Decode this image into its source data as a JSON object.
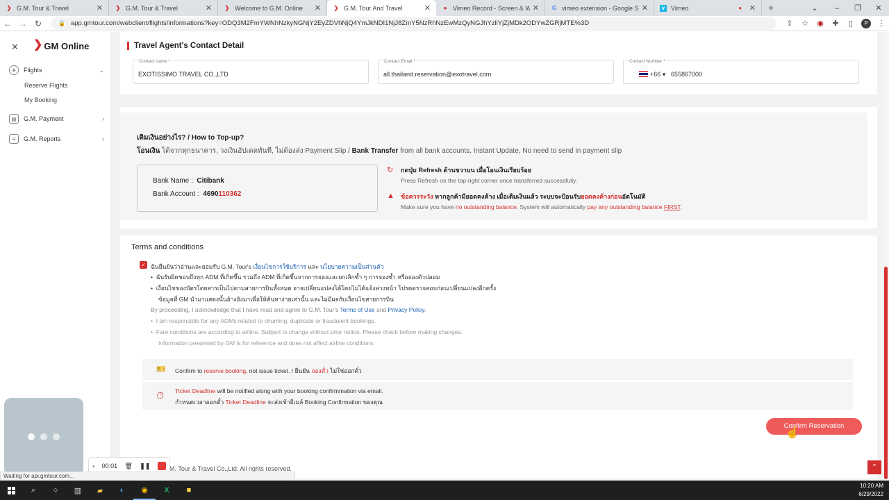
{
  "browser": {
    "tabs": [
      {
        "title": "G.M. Tour & Travel",
        "active": false
      },
      {
        "title": "G.M. Tour & Travel",
        "active": false
      },
      {
        "title": "Welcome to G.M. Online",
        "active": false
      },
      {
        "title": "G.M. Tour And Travel",
        "active": true
      },
      {
        "title": "Vimeo Record - Screen & Webc",
        "active": false
      },
      {
        "title": "vimeo extension - Google Searc",
        "active": false
      },
      {
        "title": "Vimeo",
        "active": false
      }
    ],
    "new_tab": "+",
    "url": "app.gmtour.com/webclient/flights/informations?key=ODQ3M2FmYWNhNzkyNGNjY2EyZDVhNjQ4YmJkNDI1NjJ8ZmY5NzRhNzEwMzQyNGJhYzllYjZjMDk2ODYwZGRjMTE%3D",
    "status": "Waiting for api.gmtour.com..."
  },
  "sidebar": {
    "logo": "GM Online",
    "items": [
      {
        "label": "Flights"
      },
      {
        "label": "G.M. Payment"
      },
      {
        "label": "G.M. Reports"
      }
    ],
    "sub_items": [
      "Reserve Flights",
      "My Booking"
    ]
  },
  "contact": {
    "title": "Travel Agent's Contact Detail",
    "name_label": "Contact name *",
    "name_value": "EXOTISSIMO TRAVEL CO.,LTD",
    "email_label": "Contact Email *",
    "email_value": "all.thailand.reservation@exotravel.com",
    "number_label": "Contact Number *",
    "country_code": "+66",
    "number_value": "655867000"
  },
  "topup": {
    "title": "เติมเงินอย่างไร? / How to Top-up?",
    "line_bold1": "โอนเงิน",
    "line_text1": " ได้จากทุกธนาคาร, วงเงินอัปเดตทันที, ไม่ต้องส่ง Payment Slip / ",
    "line_bold2": "Bank Transfer",
    "line_text2": " from all bank accounts, Instant Update, No need to send in payment slip",
    "bank_name_label": "Bank Name :",
    "bank_name": "Citibank",
    "bank_account_label": "Bank Account :",
    "bank_account_prefix": "4690",
    "bank_account_suffix": "110362",
    "refresh_title": "กดปุ่ม Refresh ด้านขวาบน เมื่อโอนเงินเรียบร้อย",
    "refresh_sub": "Press Refresh on the top-right corner once transferred successfully.",
    "warn_red": "ข้อควรระวัง",
    "warn_title1": " หากลูกค้ามียอดคงค้าง เมื่อเติมเงินแล้ว ระบบจะป้อนรับ",
    "warn_red2": "ยอดคงค้างก่อน",
    "warn_title2": "อัตโนมัติ",
    "warn_sub1": "Make sure you have ",
    "warn_sub_red1": "no outstanding balance",
    "warn_sub2": ". System will automatically ",
    "warn_sub_red2": "pay any outstanding balance",
    "warn_sub_red3": "FIRST",
    "warn_sub3": "."
  },
  "terms": {
    "title": "Terms and conditions",
    "agree_th": "ฉันยืนยันว่าอ่านและยอมรับ G.M. Tour's ",
    "agree_th_link1": "เงื่อนไขการใช้บริการ",
    "agree_th_and": " และ ",
    "agree_th_link2": "นโยบายความเป็นส่วนตัว",
    "th_bullets": [
      "ฉันรับผิดชอบถึงทุก ADM ที่เกิดขึ้น รวมถึง ADM ที่เกิดขึ้นจากการจองและยกเลิกซ้ำ ๆ การจองซ้ำ หรือจองตัวปลอม",
      "เงื่อนไขของบัตรโดยสารเป็นไปตามสายการบินทั้งหมด อาจเปลี่ยนแปลงได้โดยไม่ได้แจ้งล่วงหน้า โปรดตรวจสอบก่อนเปลี่ยนแปลงอีกครั้ง",
      "ข้อมูลที่ GM นำมาแสดงนั้นอ้างอิงมาเพื่อให้ค้นหาง่ายเท่านั้น และไม่มีผลกับเงื่อนไขสายการบิน"
    ],
    "agree_en": "By proceeding, I acknowledge that I have read and agree to G.M. Tour's ",
    "agree_en_link1": "Terms of Use",
    "agree_en_and": " and ",
    "agree_en_link2": "Privacy Policy.",
    "en_bullets": [
      "I am responsible for any ADMs related to churning, duplicate or fraudulent bookings.",
      "Fare conditions are according to airline. Subject to change without prior notice. Please check before making changes.",
      "Information presented by GM is for reference and does not affect airline conditions."
    ],
    "confirm1_a": "Confirm to ",
    "confirm1_red": "reserve booking",
    "confirm1_b": ", not issue ticket. / ยืนยัน ",
    "confirm1_red2": "จองตั๋ว",
    "confirm1_c": " ไม่ใช่ออกตั๋ว",
    "confirm2_red": "Ticket Deadline",
    "confirm2_a": " will be notified along with your booking confirmmation via email.",
    "confirm3_a": "กำหนดเวลาออกตั๋ว ",
    "confirm3_red": "Ticket Deadline",
    "confirm3_b": " จะส่งเข้าอีเมล์ Booking Confirmation ของคุณ",
    "button": "Confirm Reservation"
  },
  "footer": {
    "text": "M. Tour & Travel Co.,Ltd. All rights reserved."
  },
  "recorder": {
    "time": "00:01"
  },
  "taskbar": {
    "time": "10:20 AM",
    "date": "6/29/2022"
  },
  "colors": {
    "brand": "#d32f2f",
    "button": "#ef5b5b"
  }
}
